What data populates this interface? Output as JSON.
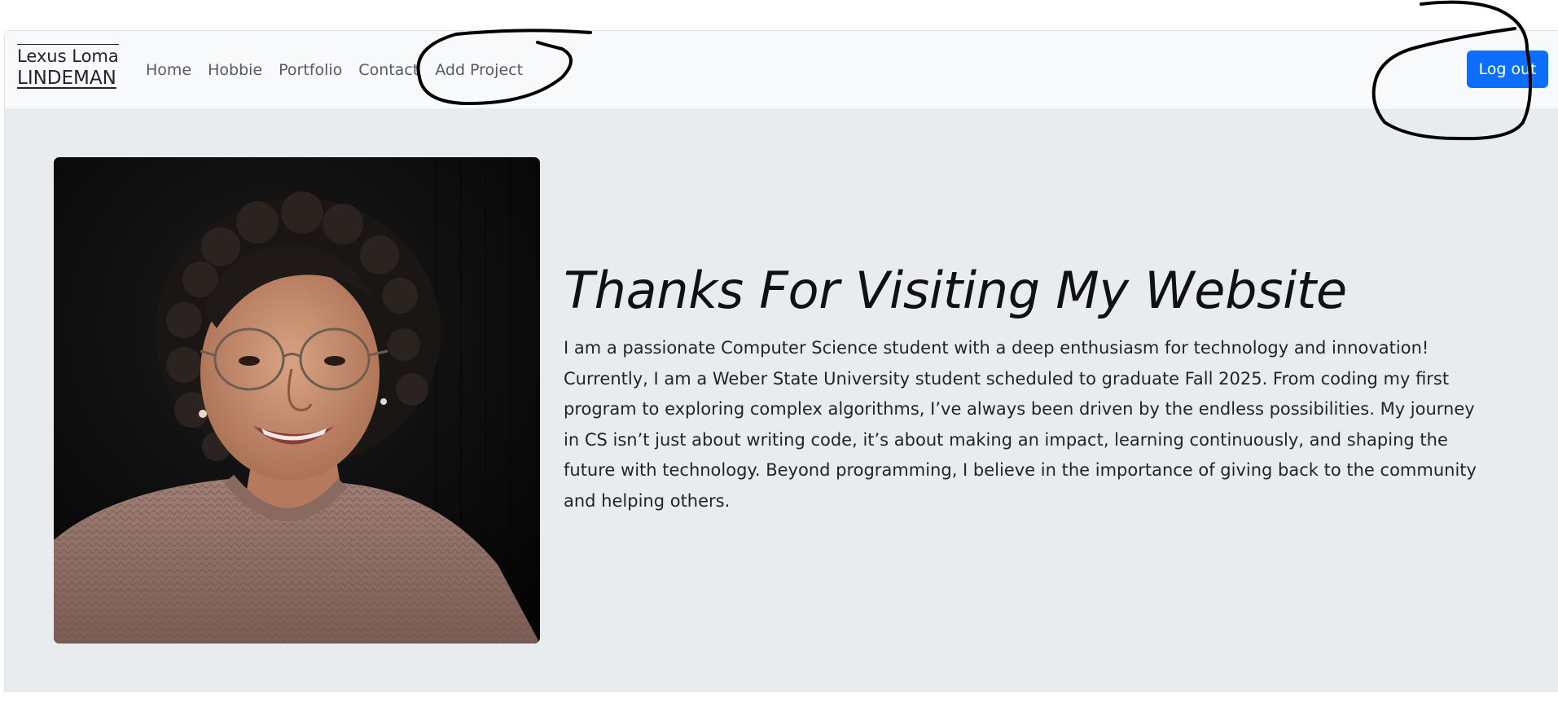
{
  "brand": {
    "line1": "Lexus Loma",
    "line2": "LINDEMAN"
  },
  "nav": {
    "items": [
      {
        "label": "Home"
      },
      {
        "label": "Hobbie"
      },
      {
        "label": "Portfolio"
      },
      {
        "label": "Contact"
      },
      {
        "label": "Add Project"
      }
    ]
  },
  "auth": {
    "logout_label": "Log out"
  },
  "hero": {
    "title": "Thanks For Visiting My Website",
    "bio": "I am a passionate Computer Science student with a deep enthusiasm for technology and innovation! Currently, I am a Weber State University student scheduled to graduate Fall 2025. From coding my first program to exploring complex algorithms, I’ve always been driven by the endless possibilities. My journey in CS isn’t just about writing code, it’s about making an impact, learning continuously, and shaping the future with technology. Beyond programming, I believe in the importance of giving back to the community and helping others."
  },
  "colors": {
    "navbar_bg": "#f8f9fa",
    "hero_bg": "#e9ecef",
    "primary_button": "#0d6efd",
    "annotation_ink": "#000000"
  },
  "annotations": [
    {
      "icon": "hand-drawn-circle-annotation",
      "target": "Add Project"
    },
    {
      "icon": "hand-drawn-circle-annotation",
      "target": "Log out"
    }
  ]
}
